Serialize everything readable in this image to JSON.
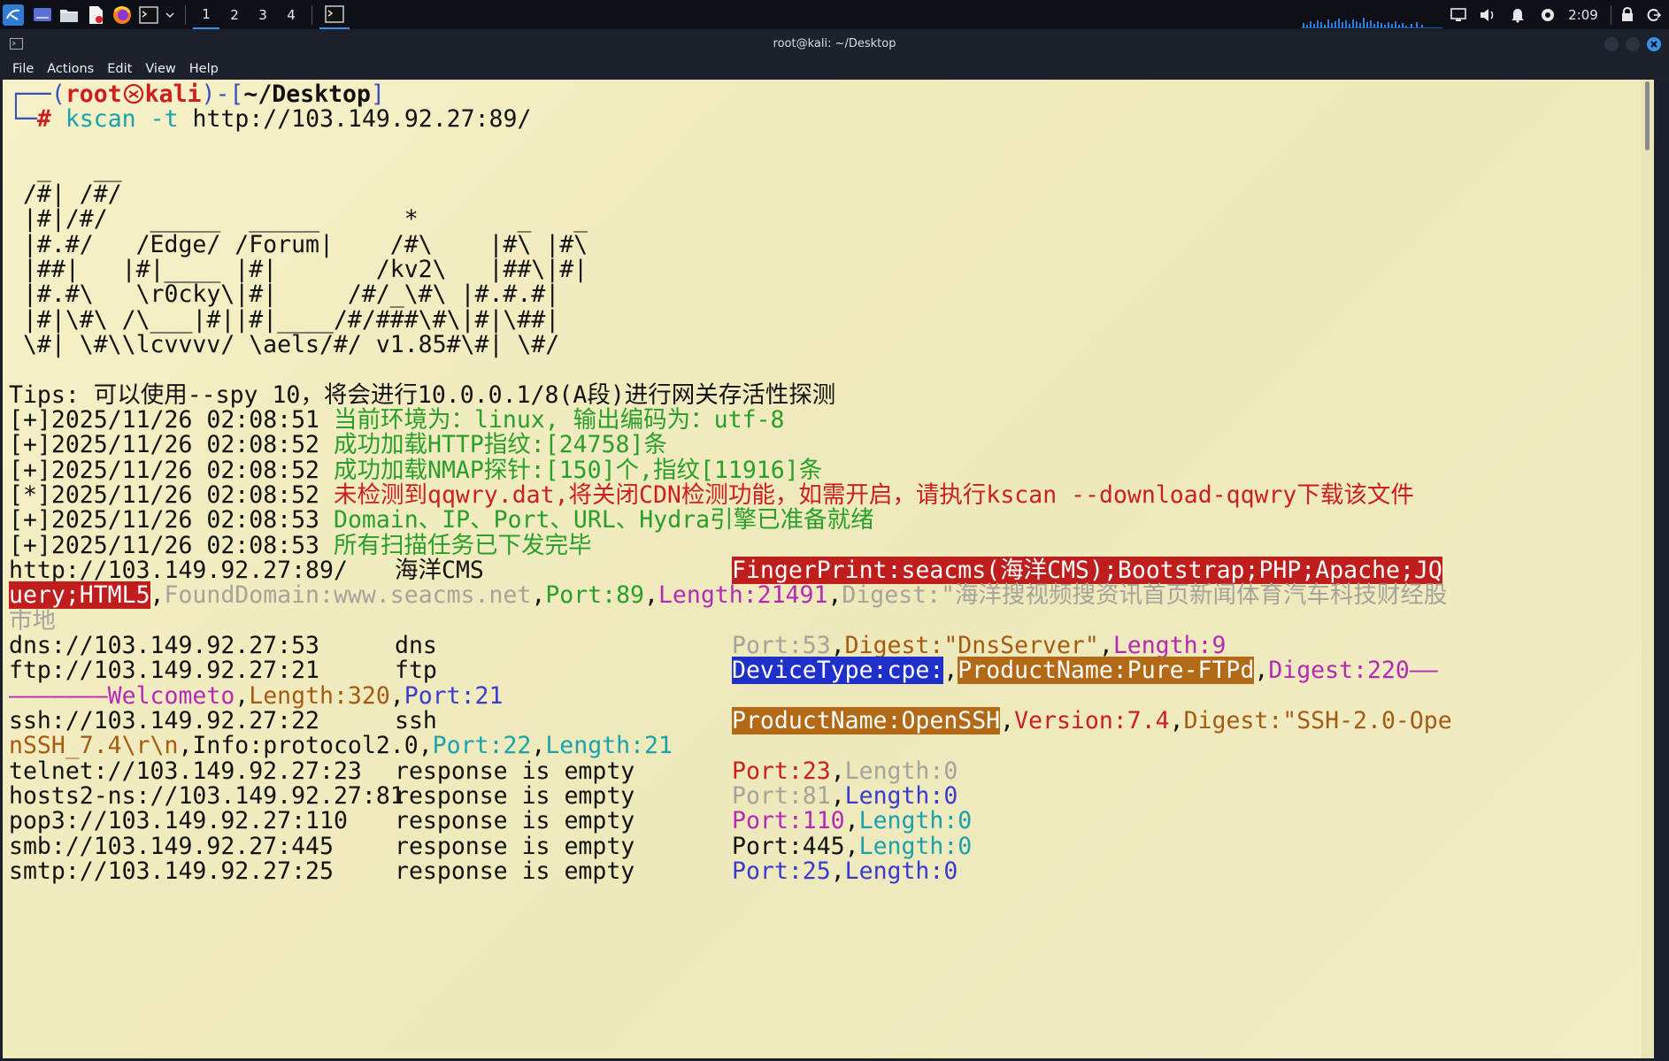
{
  "panel": {
    "workspaces": [
      "1",
      "2",
      "3",
      "4"
    ],
    "active_workspace": 0,
    "clock": "2:09",
    "icons": [
      "kali-menu-icon",
      "desktop-icon",
      "folder-icon",
      "text-editor-icon",
      "firefox-icon",
      "terminal-icon",
      "dropdown-icon",
      "terminal-window-icon",
      "display-icon",
      "volume-icon",
      "notification-icon",
      "power-manager-icon",
      "lock-icon",
      "logout-icon"
    ]
  },
  "window": {
    "title": "root@kali: ~/Desktop"
  },
  "menu": [
    "File",
    "Actions",
    "Edit",
    "View",
    "Help"
  ],
  "prompt": {
    "open": "┌──(",
    "user": "root",
    "host": "kali",
    "mid": ")-[",
    "dir": "~/Desktop",
    "close": "]",
    "hash_prefix": "└─",
    "hash": "#",
    "cmd_name": "kscan",
    "cmd_flag": "-t",
    "cmd_target": "http://103.149.92.27:89/"
  },
  "banner": [
    "  _   __",
    " /#| /#/",
    " |#|/#/   _____  _____      *       _   _",
    " |#.#/   /Edge/ /Forum|    /#\\    |#\\ |#\\",
    " |##|   |#|____ |#|       /kv2\\   |##\\|#|",
    " |#.#\\   \\r0cky\\|#|     /#/_\\#\\ |#.#.#|",
    " |#|\\#\\ /\\___|#||#|____/#/###\\#\\|#|\\##|",
    " \\#| \\#\\\\lcvvvv/ \\aels/#/ v1.85#\\#| \\#/"
  ],
  "tips": "Tips: 可以使用--spy 10，将会进行10.0.0.1/8(A段)进行网关存活性探测",
  "logs": [
    {
      "prefix": "[+]",
      "time": "2025/11/26 02:08:51",
      "msg": "当前环境为：linux, 输出编码为：utf-8",
      "level": "info"
    },
    {
      "prefix": "[+]",
      "time": "2025/11/26 02:08:52",
      "msg": "成功加载HTTP指纹:[24758]条",
      "level": "info"
    },
    {
      "prefix": "[+]",
      "time": "2025/11/26 02:08:52",
      "msg": "成功加载NMAP探针:[150]个,指纹[11916]条",
      "level": "info"
    },
    {
      "prefix": "[*]",
      "time": "2025/11/26 02:08:52",
      "msg": "未检测到qqwry.dat,将关闭CDN检测功能，如需开启，请执行kscan --download-qqwry下载该文件",
      "level": "warn"
    },
    {
      "prefix": "[+]",
      "time": "2025/11/26 02:08:53",
      "msg": "Domain、IP、Port、URL、Hydra引擎已准备就绪",
      "level": "info"
    },
    {
      "prefix": "[+]",
      "time": "2025/11/26 02:08:53",
      "msg": "所有扫描任务已下发完毕",
      "level": "info"
    }
  ],
  "results": {
    "http": {
      "url": "http://103.149.92.27:89/",
      "name": "海洋CMS",
      "fingerprint_a": "FingerPrint:seacms(海洋CMS);Bootstrap;PHP;Apache;JQ",
      "fingerprint_b": "uery;HTML5",
      "sep": ",",
      "found_domain": "FoundDomain:www.seacms.net",
      "port": "Port:89",
      "length": "Length:21491",
      "digest_a": "Digest:\"海洋搜视频搜资讯首页新闻体育汽车科技财经股",
      "digest_b": "市地"
    },
    "dns": {
      "url": "dns://103.149.92.27:53",
      "name": "dns",
      "port": "Port:53",
      "digest": "Digest:\"DnsServer\"",
      "length": "Length:9"
    },
    "ftp": {
      "url": "ftp://103.149.92.27:21",
      "name": "ftp",
      "device": "DeviceType:cpe:",
      "product": "ProductName:Pure-FTPd",
      "digest_a": "Digest:220——",
      "digest_b": "———————Welcometo",
      "length": "Length:320",
      "port": "Port:21"
    },
    "ssh": {
      "url": "ssh://103.149.92.27:22",
      "name": "ssh",
      "product": "ProductName:OpenSSH",
      "version": "Version:7.4",
      "digest_a": "Digest:\"SSH-2.0-Ope",
      "digest_b": "nSSH_7.4\\r\\n",
      "info": "Info:protocol2.0",
      "port": "Port:22",
      "length": "Length:21"
    },
    "empty": [
      {
        "url": "telnet://103.149.92.27:23",
        "status": "response is empty",
        "port": "Port:23",
        "length": "Length:0",
        "port_color": "#cc1f1f",
        "length_color": "#a5a39a"
      },
      {
        "url": "hosts2-ns://103.149.92.27:81",
        "status": "response is empty",
        "port": "Port:81",
        "length": "Length:0",
        "port_color": "#a5a39a",
        "length_color": "#3a3ad0"
      },
      {
        "url": "pop3://103.149.92.27:110",
        "status": "response is empty",
        "port": "Port:110",
        "length": "Length:0",
        "port_color": "#b52ab5",
        "length_color": "#1aa1ad"
      },
      {
        "url": "smb://103.149.92.27:445",
        "status": "response is empty",
        "port": "Port:445",
        "length": "Length:0",
        "port_color": "#121212",
        "length_color": "#1aa1ad"
      },
      {
        "url": "smtp://103.149.92.27:25",
        "status": "response is empty",
        "port": "Port:25",
        "length": "Length:0",
        "port_color": "#3a3ad0",
        "length_color": "#3a3ad0"
      }
    ]
  },
  "colors": {
    "terminal_bg": "#f3eec4",
    "panel_bg": "#0d1017",
    "accent": "#3c8ee0"
  }
}
